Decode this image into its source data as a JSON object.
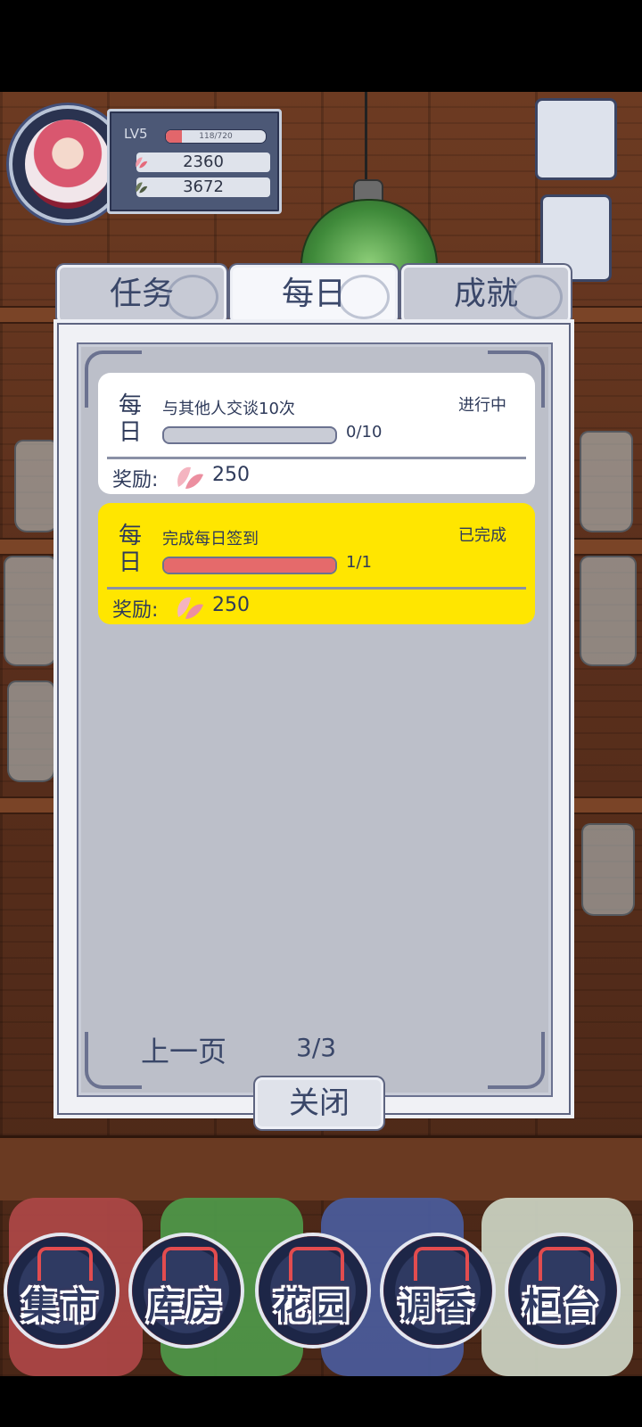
{
  "hud": {
    "level": "LV5",
    "xp_text": "118/720",
    "xp_fraction": 0.164,
    "petal_count": "2360",
    "leaf_count": "3672"
  },
  "tabs": [
    {
      "label": "任务",
      "active": false
    },
    {
      "label": "每日",
      "active": true
    },
    {
      "label": "成就",
      "active": false
    }
  ],
  "tasks": [
    {
      "frequency": "每\n日",
      "title": "与其他人交谈10次",
      "status": "进行中",
      "progress_text": "0/10",
      "progress_fraction": 0,
      "reward_label": "奖励:",
      "reward_value": "250",
      "background": "#ffffff"
    },
    {
      "frequency": "每\n日",
      "title": "完成每日签到",
      "status": "已完成",
      "progress_text": "1/1",
      "progress_fraction": 1,
      "reward_label": "奖励:",
      "reward_value": "250",
      "background": "#ffe600"
    }
  ],
  "pager": {
    "prev_label": "上一页",
    "page": "3/3"
  },
  "close_label": "关闭",
  "nav": [
    {
      "label": "集市",
      "icon": "gate-icon"
    },
    {
      "label": "库房",
      "icon": "warehouse-icon"
    },
    {
      "label": "花园",
      "icon": "rose-icon"
    },
    {
      "label": "调香",
      "icon": "perfume-icon"
    },
    {
      "label": "柜台",
      "icon": "counter-icon"
    }
  ],
  "colors": {
    "accent_red": "#e56a6b",
    "completed_yellow": "#ffe600",
    "navy": "#2e3a5a"
  }
}
